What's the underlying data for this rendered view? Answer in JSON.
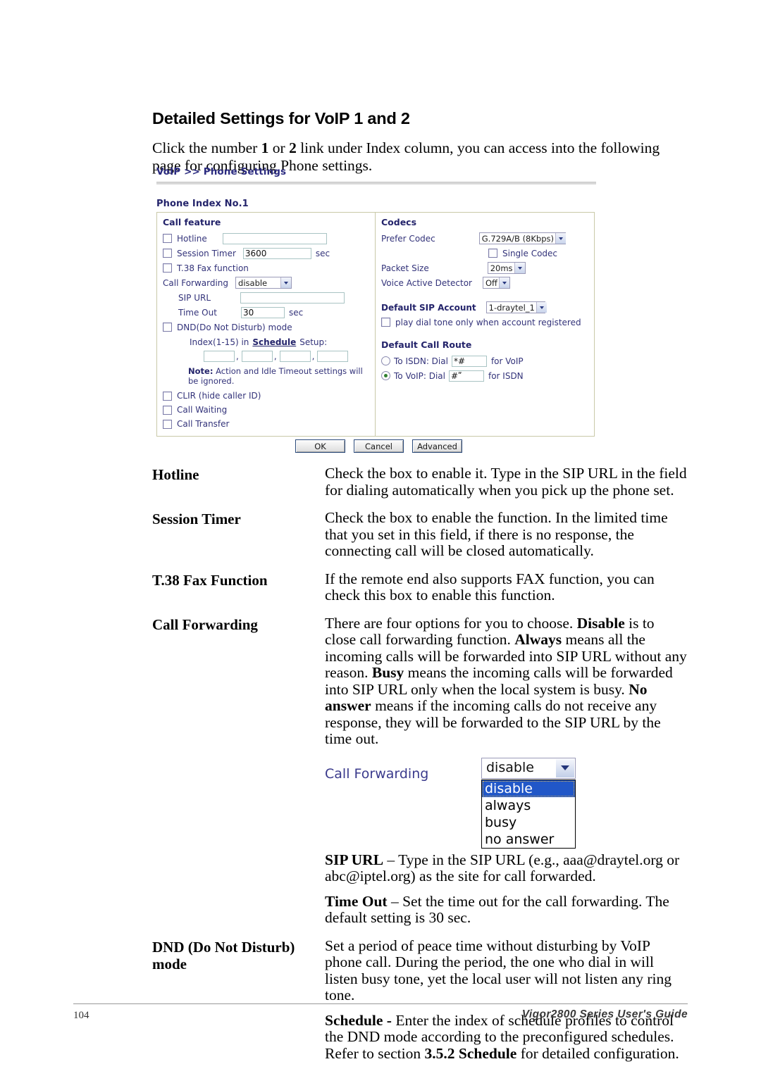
{
  "heading": "Detailed Settings for VoIP 1 and 2",
  "intro": {
    "part1": "Click the number ",
    "bold1": "1",
    "part2": " or ",
    "bold2": "2",
    "part3": " link under Index column, you can access into the following page for configuring Phone settings."
  },
  "ui": {
    "breadcrumb": "VoIP >> Phone Settings",
    "subtitle": "Phone Index No.1",
    "left": {
      "title": "Call feature",
      "hotline_label": "Hotline",
      "hotline_value": "",
      "session_timer_label": "Session Timer",
      "session_timer_value": "3600",
      "session_timer_unit": "sec",
      "fax_label": "T.38 Fax function",
      "call_forwarding_label": "Call Forwarding",
      "call_forwarding_value": "disable",
      "sip_url_label": "SIP URL",
      "sip_url_value": "",
      "time_out_label": "Time Out",
      "time_out_value": "30",
      "time_out_unit": "sec",
      "dnd_label": "DND(Do Not Disturb) mode",
      "index_prefix": "Index(1-15) in",
      "schedule_link": "Schedule",
      "index_suffix": "Setup:",
      "schedule_indexes": [
        "",
        "",
        "",
        ""
      ],
      "note_title": "Note:",
      "note_text": "Action and Idle Timeout settings will be ignored.",
      "clir_label": "CLIR (hide caller ID)",
      "call_waiting_label": "Call Waiting",
      "call_transfer_label": "Call Transfer"
    },
    "right": {
      "codecs_title": "Codecs",
      "prefer_codec_label": "Prefer Codec",
      "prefer_codec_value": "G.729A/B (8Kbps)",
      "single_codec_label": "Single Codec",
      "packet_size_label": "Packet Size",
      "packet_size_value": "20ms",
      "vad_label": "Voice Active Detector",
      "vad_value": "Off",
      "sip_account_title": "Default SIP Account",
      "sip_account_value": "1-draytel_1",
      "dial_tone_label": "play dial tone only when account registered",
      "call_route_title": "Default Call Route",
      "isdn_prefix": "To ISDN: Dial",
      "isdn_value": "*#",
      "isdn_suffix": "for VoIP",
      "voip_prefix": "To VoIP: Dial",
      "voip_value": "#ʺ",
      "voip_suffix": "for ISDN"
    },
    "buttons": {
      "ok": "OK",
      "cancel": "Cancel",
      "advanced": "Advanced"
    }
  },
  "definitions": [
    {
      "term": "Hotline",
      "paragraphs": [
        "Check the box to enable it. Type in the SIP URL in the field for dialing automatically when you pick up the phone set."
      ]
    },
    {
      "term": "Session Timer",
      "paragraphs": [
        "Check the box to enable the function. In the limited time that you set in this field, if there is no response, the connecting call will be closed automatically."
      ]
    },
    {
      "term": "T.38 Fax Function",
      "paragraphs": [
        "If the remote end also supports FAX function, you can check this box to enable this function."
      ]
    }
  ],
  "call_forwarding": {
    "term": "Call Forwarding",
    "desc_segments": [
      {
        "t": "There are four options for you to choose. ",
        "b": false
      },
      {
        "t": "Disable",
        "b": true
      },
      {
        "t": " is to close call forwarding function. ",
        "b": false
      },
      {
        "t": "Always",
        "b": true
      },
      {
        "t": " means all the incoming calls will be forwarded into SIP URL without any reason. ",
        "b": false
      },
      {
        "t": "Busy",
        "b": true
      },
      {
        "t": " means the incoming calls will be forwarded into SIP URL only when the local system is busy. ",
        "b": false
      },
      {
        "t": "No answer",
        "b": true
      },
      {
        "t": " means if the incoming calls do not receive any response, they will be forwarded to the SIP URL by the time out.",
        "b": false
      }
    ],
    "figure": {
      "label": "Call Forwarding",
      "selected": "disable",
      "options": [
        "disable",
        "always",
        "busy",
        "no answer"
      ]
    },
    "sip_url_segments": [
      {
        "t": "SIP URL",
        "b": true
      },
      {
        "t": " – Type in the SIP URL (e.g., aaa@draytel.org or abc@iptel.org) as the site for call forwarded.",
        "b": false
      }
    ],
    "time_out_segments": [
      {
        "t": "Time Out",
        "b": true
      },
      {
        "t": " – Set the time out for the call forwarding. The default setting is 30 sec.",
        "b": false
      }
    ]
  },
  "dnd": {
    "term_line1": "DND (Do Not Disturb)",
    "term_line2": "mode",
    "paragraph1": "Set a period of peace time without disturbing by VoIP phone call. During the period, the one who dial in will listen busy tone, yet the local user will not listen any ring tone.",
    "schedule_segments": [
      {
        "t": "Schedule - ",
        "b": true
      },
      {
        "t": "Enter the index of schedule profiles to control the DND mode according to the preconfigured schedules. Refer to section ",
        "b": false
      },
      {
        "t": "3.5.2 Schedule",
        "b": true
      },
      {
        "t": " for detailed configuration.",
        "b": false
      }
    ]
  },
  "footer": {
    "page_number": "104",
    "guide": "Vigor2800 Series User's Guide"
  }
}
